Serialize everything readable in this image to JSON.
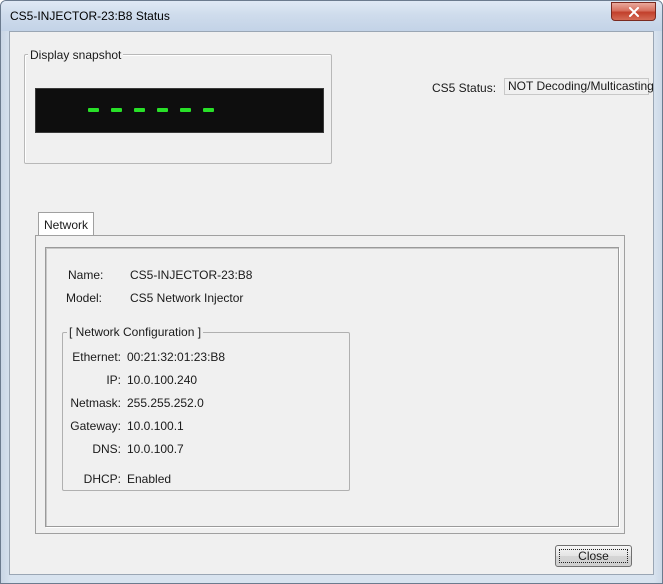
{
  "window": {
    "title": "CS5-INJECTOR-23:B8 Status"
  },
  "snapshot": {
    "group_label": "Display snapshot",
    "dash_count": 6,
    "dash_color": "#28e028"
  },
  "status": {
    "label": "CS5 Status:",
    "value": "NOT Decoding/Multicasting"
  },
  "tabs": [
    {
      "label": "Network"
    }
  ],
  "network": {
    "name_label": "Name:",
    "name_value": "CS5-INJECTOR-23:B8",
    "model_label": "Model:",
    "model_value": "CS5 Network Injector",
    "config_group_label": "[ Network Configuration ]",
    "ethernet_label": "Ethernet:",
    "ethernet_value": "00:21:32:01:23:B8",
    "ip_label": "IP:",
    "ip_value": "10.0.100.240",
    "netmask_label": "Netmask:",
    "netmask_value": "255.255.252.0",
    "gateway_label": "Gateway:",
    "gateway_value": "10.0.100.1",
    "dns_label": "DNS:",
    "dns_value": "10.0.100.7",
    "dhcp_label": "DHCP:",
    "dhcp_value": "Enabled"
  },
  "buttons": {
    "close_label": "Close"
  },
  "icons": {
    "window_close": "close-x-icon"
  }
}
